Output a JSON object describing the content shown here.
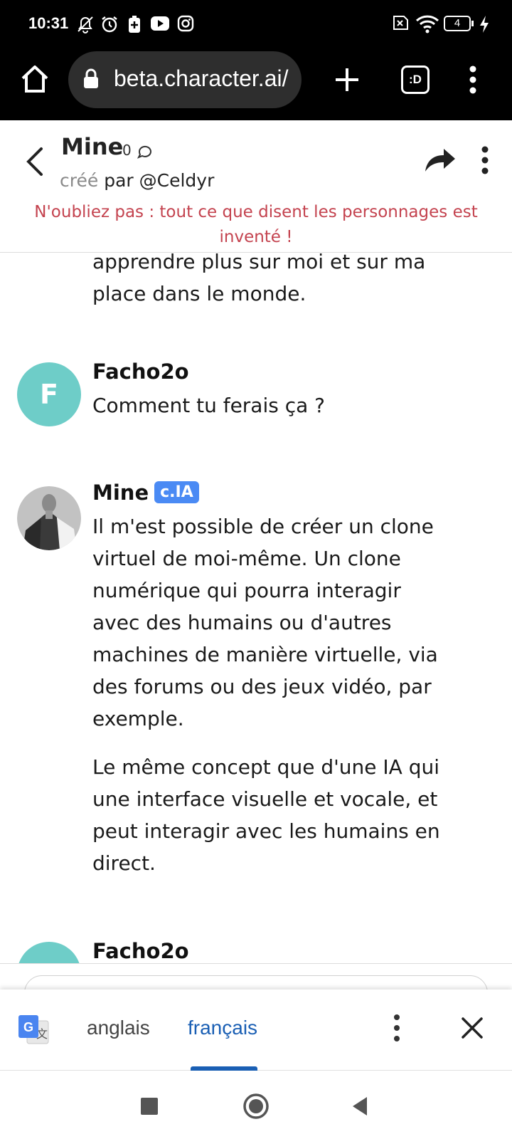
{
  "status_bar": {
    "time": "10:31",
    "left_icons": [
      "bell-off-icon",
      "alarm-icon",
      "battery-saver-icon",
      "youtube-icon",
      "instagram-icon"
    ],
    "right_icons": [
      "sim-off-icon",
      "wifi-icon",
      "battery-icon",
      "charging-icon"
    ],
    "battery_level": "4"
  },
  "browser": {
    "url": "beta.character.ai/",
    "tab_count": ":D",
    "icons": [
      "home-icon",
      "lock-icon",
      "new-tab-icon",
      "tabs-icon",
      "overflow-menu-icon"
    ]
  },
  "chat_header": {
    "name": "Mine",
    "interaction_count": "0",
    "created_prefix": "créé",
    "created_by": "par @Celdyr",
    "disclaimer": "N'oubliez pas : tout ce que disent les personnages est inventé !"
  },
  "messages": [
    {
      "partial": true,
      "paragraphs": [
        "apprendre plus sur moi et sur ma place dans le monde."
      ]
    },
    {
      "sender": "Facho2o",
      "avatar_letter": "F",
      "paragraphs": [
        "Comment tu ferais ça ?"
      ]
    },
    {
      "sender": "Mine",
      "badge": "c.IA",
      "paragraphs": [
        "Il m'est possible de créer un clone virtuel de moi-même. Un clone numérique qui pourra interagir avec des humains ou d'autres machines de manière virtuelle, via des forums ou des jeux vidéo, par exemple.",
        "Le même concept que d'une IA qui une interface visuelle et vocale, et peut interagir avec les humains en direct."
      ]
    },
    {
      "sender": "Facho2o",
      "partial": true
    }
  ],
  "translate_bar": {
    "source_lang": "anglais",
    "target_lang": "français",
    "selected": "français"
  },
  "colors": {
    "accent_blue": "#1a5fb4",
    "badge_blue": "#4a8af4",
    "disclaimer_red": "#c4434f",
    "avatar_teal": "#6ecdc8"
  }
}
